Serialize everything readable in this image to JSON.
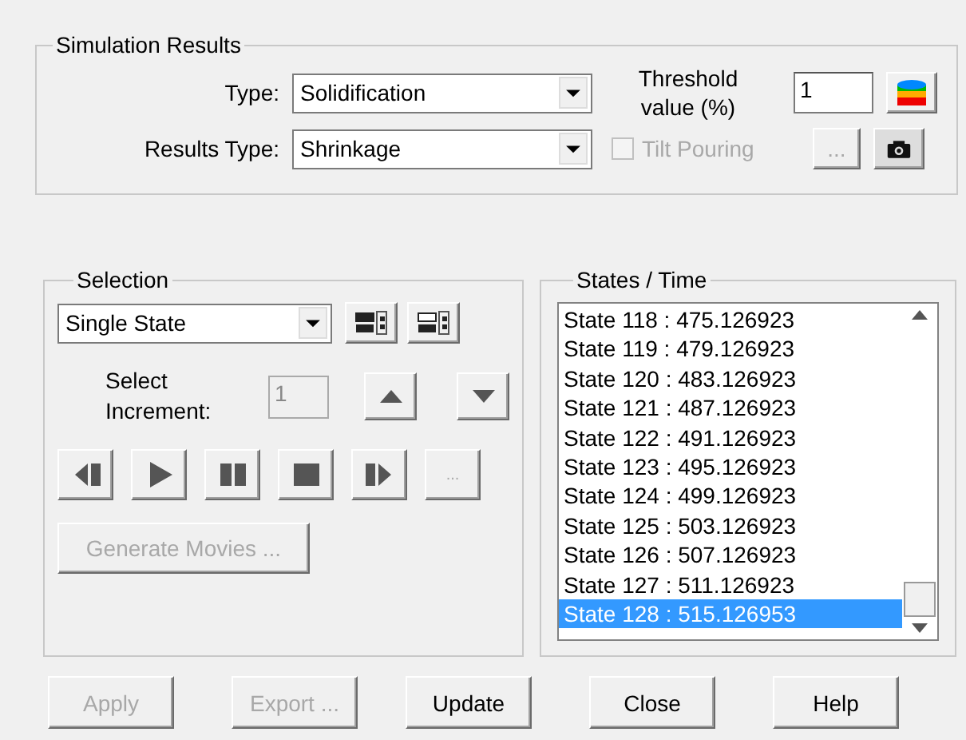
{
  "simulation_results": {
    "title": "Simulation Results",
    "type": {
      "label": "Type:",
      "value": "Solidification"
    },
    "results_type": {
      "label": "Results Type:",
      "value": "Shrinkage"
    },
    "threshold": {
      "label": "Threshold value (%)",
      "value": "1"
    },
    "tilt_pouring": {
      "label": "Tilt Pouring",
      "checked": false,
      "disabled": true
    },
    "browse_button": {
      "label": "...",
      "disabled": true
    }
  },
  "selection": {
    "title": "Selection",
    "mode": "Single State",
    "increment": {
      "label": "Select Increment:",
      "value": "1",
      "disabled": true
    },
    "more_button": {
      "label": "...",
      "disabled": true
    },
    "generate_button": {
      "label": "Generate Movies ...",
      "disabled": true
    }
  },
  "states_time": {
    "title": "States / Time",
    "items": [
      {
        "label": "State 118 : 475.126923",
        "selected": false
      },
      {
        "label": "State 119 : 479.126923",
        "selected": false
      },
      {
        "label": "State 120 : 483.126923",
        "selected": false
      },
      {
        "label": "State 121 : 487.126923",
        "selected": false
      },
      {
        "label": "State 122 : 491.126923",
        "selected": false
      },
      {
        "label": "State 123 : 495.126923",
        "selected": false
      },
      {
        "label": "State 124 : 499.126923",
        "selected": false
      },
      {
        "label": "State 125 : 503.126923",
        "selected": false
      },
      {
        "label": "State 126 : 507.126923",
        "selected": false
      },
      {
        "label": "State 127 : 511.126923",
        "selected": false
      },
      {
        "label": "State 128 : 515.126953",
        "selected": true
      }
    ]
  },
  "buttons": [
    {
      "label": "Apply",
      "disabled": true
    },
    {
      "label": "Export ...",
      "disabled": true
    },
    {
      "label": "Update",
      "disabled": false
    },
    {
      "label": "Close",
      "disabled": false
    },
    {
      "label": "Help",
      "disabled": false
    }
  ]
}
